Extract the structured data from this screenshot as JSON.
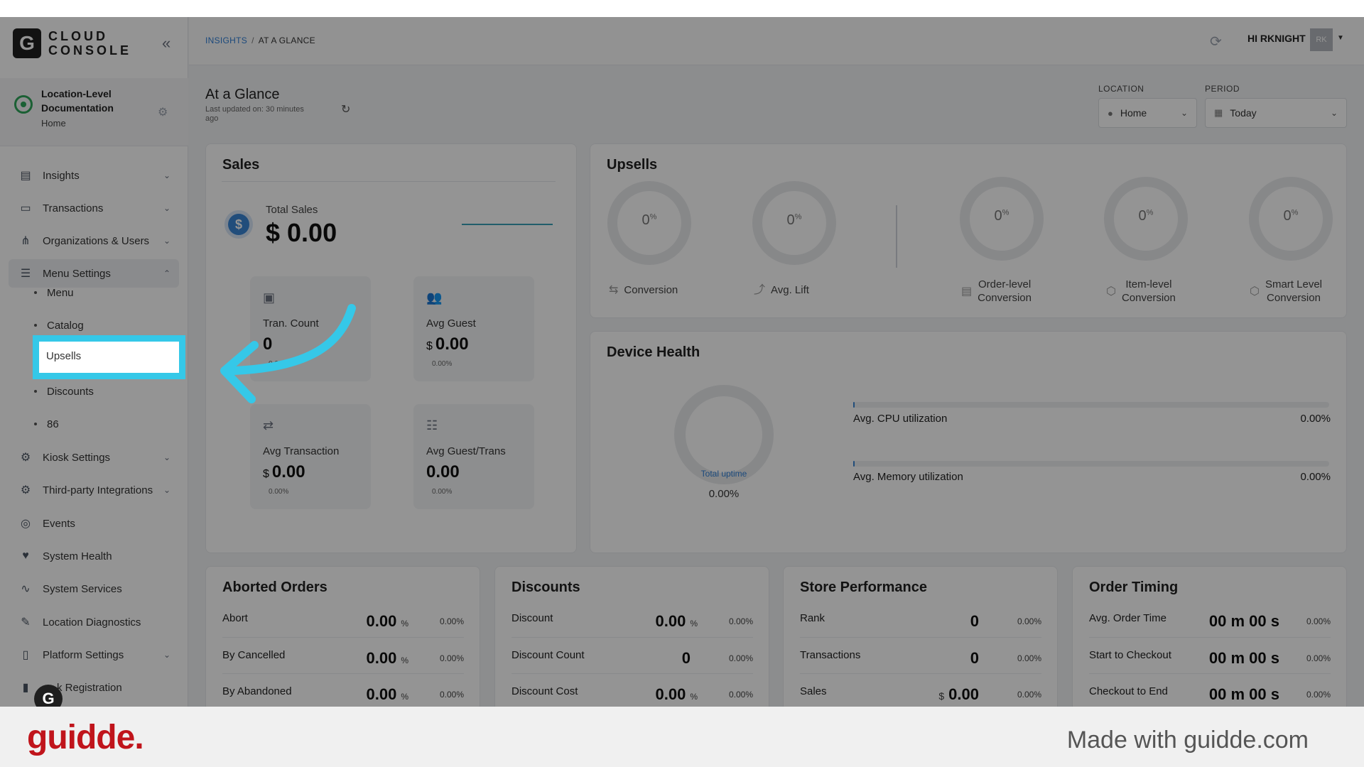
{
  "app": {
    "brand_letter": "G",
    "brand_line1": "CLOUD",
    "brand_line2": "CONSOLE"
  },
  "location": {
    "title": "Location-Level Documentation",
    "subtitle": "Home"
  },
  "sidebar": {
    "items": [
      {
        "label": "Insights",
        "icon": "chart-icon"
      },
      {
        "label": "Transactions",
        "icon": "receipt-icon"
      },
      {
        "label": "Organizations & Users",
        "icon": "org-icon"
      },
      {
        "label": "Menu Settings",
        "icon": "menu-icon"
      },
      {
        "label": "Kiosk Settings",
        "icon": "gear-icon"
      },
      {
        "label": "Third-party Integrations",
        "icon": "puzzle-icon"
      },
      {
        "label": "Events",
        "icon": "events-icon"
      },
      {
        "label": "System Health",
        "icon": "heart-icon"
      },
      {
        "label": "System Services",
        "icon": "pulse-icon"
      },
      {
        "label": "Location Diagnostics",
        "icon": "wrench-icon"
      },
      {
        "label": "Platform Settings",
        "icon": "doc-icon"
      },
      {
        "label": "k Registration",
        "icon": "kiosk-icon"
      }
    ],
    "menu_sub": [
      "Menu",
      "Catalog",
      "Upsells",
      "Discounts",
      "86"
    ]
  },
  "header": {
    "crumb1": "INSIGHTS",
    "crumb_sep": "/",
    "crumb2": "AT A GLANCE",
    "greeting": "HI RKNIGHT",
    "avatar": "RK"
  },
  "page": {
    "title": "At a Glance",
    "updated": "Last updated on: 30 minutes ago"
  },
  "filters": {
    "location_label": "LOCATION",
    "location_value": "Home",
    "period_label": "PERIOD",
    "period_value": "Today"
  },
  "sales": {
    "title": "Sales",
    "total_label": "Total Sales",
    "total_value": "$ 0.00",
    "tran_count_label": "Tran. Count",
    "tran_count_value": "0",
    "tran_count_pct": "0.00%",
    "avg_guest_label": "Avg Guest",
    "avg_guest_cur": "$",
    "avg_guest_value": "0.00",
    "avg_guest_pct": "0.00%",
    "avg_trans_label": "Avg Transaction",
    "avg_trans_cur": "$",
    "avg_trans_value": "0.00",
    "avg_trans_pct": "0.00%",
    "avg_gt_label": "Avg Guest/Trans",
    "avg_gt_value": "0.00",
    "avg_gt_pct": "0.00%",
    "icon_tran": "123"
  },
  "upsells": {
    "title": "Upsells",
    "gauge_value": "0",
    "gauge_unit": "%",
    "labels": [
      "Conversion",
      "Avg. Lift",
      "Order-level Conversion",
      "Item-level Conversion",
      "Smart Level Conversion"
    ],
    "order_l1": "Order-level",
    "order_l2": "Conversion",
    "item_l1": "Item-level",
    "item_l2": "Conversion",
    "smart_l1": "Smart Level",
    "smart_l2": "Conversion"
  },
  "device_health": {
    "title": "Device Health",
    "uptime_label": "Total uptime",
    "uptime_value": "0.00%",
    "cpu_label": "Avg. CPU utilization",
    "cpu_value": "0.00%",
    "cpu_fraction": 0.0,
    "mem_label": "Avg. Memory utilization",
    "mem_value": "0.00%",
    "mem_fraction": 0.0
  },
  "aborted": {
    "title": "Aborted Orders",
    "rows": [
      {
        "label": "Abort",
        "value": "0.00",
        "unit": "%",
        "pct": "0.00%"
      },
      {
        "label": "By Cancelled",
        "value": "0.00",
        "unit": "%",
        "pct": "0.00%"
      },
      {
        "label": "By Abandoned",
        "value": "0.00",
        "unit": "%",
        "pct": "0.00%"
      }
    ]
  },
  "discounts": {
    "title": "Discounts",
    "rows": [
      {
        "label": "Discount",
        "value": "0.00",
        "unit": "%",
        "pct": "0.00%"
      },
      {
        "label": "Discount Count",
        "value": "0",
        "unit": "",
        "pct": "0.00%"
      },
      {
        "label": "Discount Cost",
        "value": "0.00",
        "unit": "%",
        "pct": "0.00%"
      }
    ]
  },
  "store": {
    "title": "Store Performance",
    "rows": [
      {
        "label": "Rank",
        "value": "0",
        "cur": "",
        "pct": "0.00%"
      },
      {
        "label": "Transactions",
        "value": "0",
        "cur": "",
        "pct": "0.00%"
      },
      {
        "label": "Sales",
        "value": "0.00",
        "cur": "$",
        "pct": "0.00%"
      }
    ]
  },
  "timing": {
    "title": "Order Timing",
    "rows": [
      {
        "label": "Avg. Order Time",
        "value": "00 m 00 s",
        "pct": "0.00%"
      },
      {
        "label": "Start to Checkout",
        "value": "00 m 00 s",
        "pct": "0.00%"
      },
      {
        "label": "Checkout to End",
        "value": "00 m 00 s",
        "pct": "0.00%"
      }
    ]
  },
  "footer": {
    "logo": "guidde.",
    "made": "Made with guidde.com"
  },
  "colors": {
    "accent": "#35c8e8",
    "link": "#2f7fd6",
    "brand_red": "#c0141b"
  }
}
